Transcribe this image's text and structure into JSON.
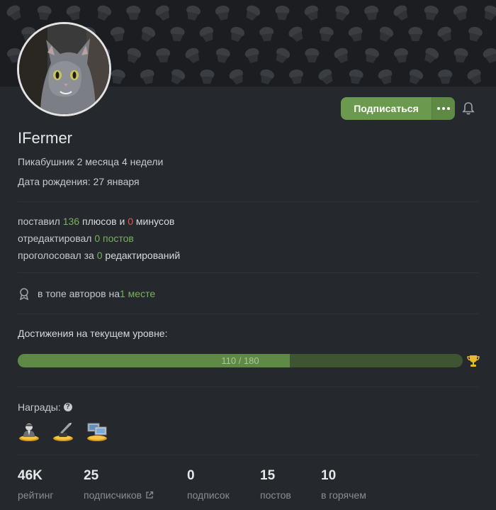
{
  "profile": {
    "username": "IFermer",
    "tenure": "Пикабушник 2 месяца 4 недели",
    "birthday": "Дата рождения: 27 января"
  },
  "actions": {
    "subscribe_label": "Подписаться"
  },
  "activity": {
    "line1": {
      "prefix": "поставил ",
      "pluses": "136",
      "middle": " плюсов и ",
      "minuses": "0",
      "suffix": " минусов"
    },
    "line2": {
      "prefix": "отредактировал ",
      "value": "0 постов"
    },
    "line3": {
      "prefix": "проголосовал за ",
      "value": "0",
      "suffix": " редактирований"
    }
  },
  "top": {
    "prefix": "в топе авторов на ",
    "value": "1 месте"
  },
  "achievements": {
    "title": "Достижения на текущем уровне:",
    "progress_label": "110 / 180",
    "progress_fraction": 0.611
  },
  "awards": {
    "title": "Награды:",
    "items": [
      "award-businessman-icon",
      "award-pen-icon",
      "award-computer-icon"
    ]
  },
  "stats": [
    {
      "value": "46K",
      "label": "рейтинг"
    },
    {
      "value": "25",
      "label": "подписчиков"
    },
    {
      "value": "0",
      "label": "подписок"
    },
    {
      "value": "15",
      "label": "постов"
    },
    {
      "value": "10",
      "label": "в горячем"
    }
  ],
  "colors": {
    "accent": "#6b9a4f",
    "positive": "#79b15a",
    "negative": "#e05a4a",
    "background": "#25292e"
  }
}
